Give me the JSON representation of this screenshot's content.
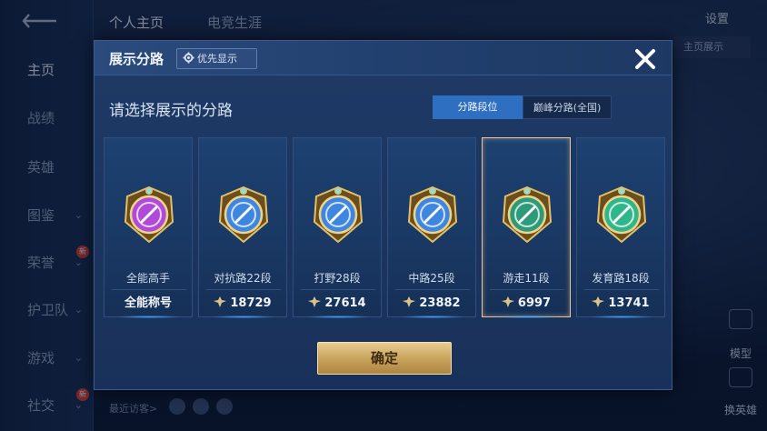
{
  "background": {
    "top_tabs": [
      "个人主页",
      "电竞生涯"
    ],
    "settings_label": "设置",
    "profile_tag": "主页展示",
    "sidebar": [
      {
        "label": "主页",
        "active": true,
        "chevron": false,
        "new": false
      },
      {
        "label": "战绩",
        "active": false,
        "chevron": false,
        "new": false
      },
      {
        "label": "英雄",
        "active": false,
        "chevron": false,
        "new": false
      },
      {
        "label": "图鉴",
        "active": false,
        "chevron": true,
        "new": false
      },
      {
        "label": "荣誉",
        "active": false,
        "chevron": true,
        "new": true
      },
      {
        "label": "护卫队",
        "active": false,
        "chevron": true,
        "new": false
      },
      {
        "label": "游戏",
        "active": false,
        "chevron": true,
        "new": false
      },
      {
        "label": "社交",
        "active": false,
        "chevron": true,
        "new": true
      }
    ],
    "new_badge": "新",
    "recent_visitors": "最近访客>",
    "right_buttons": [
      "模型",
      "换英雄"
    ]
  },
  "modal": {
    "title": "展示分路",
    "priority_button": "优先显示",
    "close_icon": "close-icon",
    "subtitle": "请选择展示的分路",
    "tabs": [
      {
        "label": "分路段位",
        "active": true
      },
      {
        "label": "巅峰分路(全国)",
        "active": false
      }
    ],
    "cards": [
      {
        "label": "全能高手",
        "footer": "全能称号",
        "has_points_icon": false,
        "selected": false,
        "emblem": "all-round-emblem-icon",
        "color": "#b04ad8"
      },
      {
        "label": "对抗路22段",
        "footer": "18729",
        "has_points_icon": true,
        "selected": false,
        "emblem": "clash-lane-emblem-icon",
        "color": "#3f86e0"
      },
      {
        "label": "打野28段",
        "footer": "27614",
        "has_points_icon": true,
        "selected": false,
        "emblem": "jungle-emblem-icon",
        "color": "#3f86e0"
      },
      {
        "label": "中路25段",
        "footer": "23882",
        "has_points_icon": true,
        "selected": false,
        "emblem": "mid-lane-emblem-icon",
        "color": "#3f86e0"
      },
      {
        "label": "游走11段",
        "footer": "6997",
        "has_points_icon": true,
        "selected": true,
        "emblem": "roam-emblem-icon",
        "color": "#2d9b7a"
      },
      {
        "label": "发育路18段",
        "footer": "13741",
        "has_points_icon": true,
        "selected": false,
        "emblem": "farm-lane-emblem-icon",
        "color": "#2fb68a"
      }
    ],
    "confirm_label": "确定",
    "accent_color": "#2f6fc2",
    "gold_color": "#c9a45d"
  }
}
